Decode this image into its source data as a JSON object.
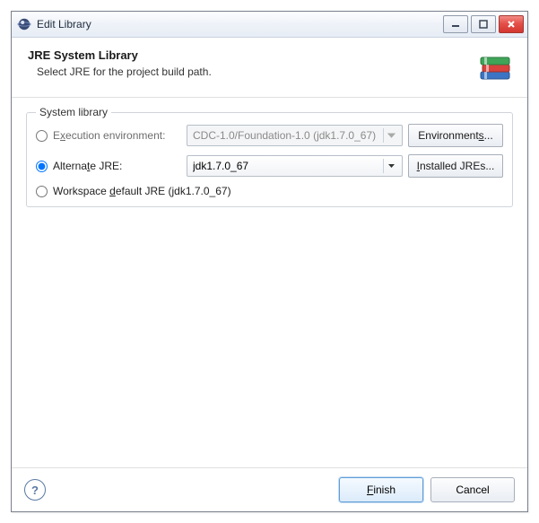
{
  "window": {
    "title": "Edit Library"
  },
  "header": {
    "title": "JRE System Library",
    "subtitle": "Select JRE for the project build path."
  },
  "group": {
    "legend": "System library",
    "exec_env": {
      "label_pre": "E",
      "mn": "x",
      "label_post": "ecution environment:",
      "value": "CDC-1.0/Foundation-1.0 (jdk1.7.0_67)",
      "btn_pre": "Environment",
      "btn_mn": "s",
      "btn_post": "..."
    },
    "alt_jre": {
      "label_pre": "Alterna",
      "mn": "t",
      "label_post": "e JRE:",
      "value": "jdk1.7.0_67",
      "btn_mn": "I",
      "btn_post": "nstalled JREs..."
    },
    "ws_default": {
      "label_pre": "Workspace ",
      "mn": "d",
      "label_post": "efault JRE (jdk1.7.0_67)"
    }
  },
  "footer": {
    "finish_mn": "F",
    "finish_post": "inish",
    "cancel": "Cancel"
  }
}
